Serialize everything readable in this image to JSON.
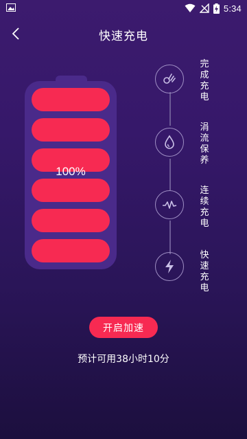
{
  "status_bar": {
    "time": "5:34",
    "icons": [
      "image-icon",
      "wifi-icon",
      "signal-icon",
      "battery-charging-icon"
    ]
  },
  "header": {
    "back_icon": "chevron-left-icon",
    "title": "快速充电"
  },
  "battery": {
    "percent_text": "100%",
    "level": 1.0,
    "cells_total": 6,
    "cells_filled": 6,
    "cell_color": "#f72a52",
    "body_color": "#4a2a8a"
  },
  "charge_steps": [
    {
      "label": "完成充电",
      "icon": "ok-hand-icon"
    },
    {
      "label": "涓流保养",
      "icon": "droplet-icon"
    },
    {
      "label": "连续充电",
      "icon": "waveform-icon"
    },
    {
      "label": "快速充电",
      "icon": "lightning-icon"
    }
  ],
  "boost_button": {
    "label": "开启加速"
  },
  "estimate_text": "预计可用38小时10分",
  "colors": {
    "accent": "#f72a52",
    "background_top": "#3c1b6e",
    "background_bottom": "#1c0f3e"
  }
}
